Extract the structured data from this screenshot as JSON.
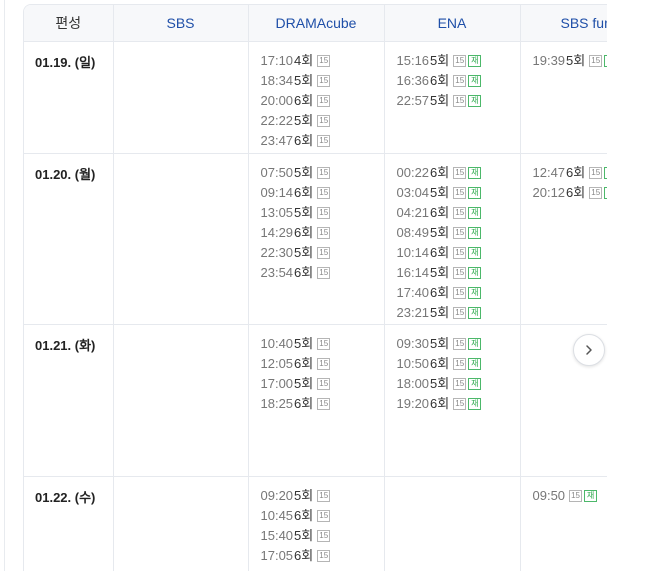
{
  "header": {
    "schedule_label": "편성",
    "channels": [
      "SBS",
      "DRAMAcube",
      "ENA",
      "SBS fun"
    ]
  },
  "badges": {
    "rating": "15",
    "rerun": "재"
  },
  "rows": [
    {
      "date": "01.19. (일)",
      "rowHeight": 112,
      "cells": [
        [],
        [
          {
            "time": "17:10",
            "ep": "4회"
          },
          {
            "time": "18:34",
            "ep": "5회"
          },
          {
            "time": "20:00",
            "ep": "6회"
          },
          {
            "time": "22:22",
            "ep": "5회"
          },
          {
            "time": "23:47",
            "ep": "6회"
          }
        ],
        [
          {
            "time": "15:16",
            "ep": "5회",
            "re": true
          },
          {
            "time": "16:36",
            "ep": "6회",
            "re": true
          },
          {
            "time": "22:57",
            "ep": "5회",
            "re": true
          }
        ],
        [
          {
            "time": "19:39",
            "ep": "5회",
            "re": true
          }
        ]
      ]
    },
    {
      "date": "01.20. (월)",
      "rowHeight": 171,
      "cells": [
        [],
        [
          {
            "time": "07:50",
            "ep": "5회"
          },
          {
            "time": "09:14",
            "ep": "6회"
          },
          {
            "time": "13:05",
            "ep": "5회"
          },
          {
            "time": "14:29",
            "ep": "6회"
          },
          {
            "time": "22:30",
            "ep": "5회"
          },
          {
            "time": "23:54",
            "ep": "6회"
          }
        ],
        [
          {
            "time": "00:22",
            "ep": "6회",
            "re": true
          },
          {
            "time": "03:04",
            "ep": "5회",
            "re": true
          },
          {
            "time": "04:21",
            "ep": "6회",
            "re": true
          },
          {
            "time": "08:49",
            "ep": "5회",
            "re": true
          },
          {
            "time": "10:14",
            "ep": "6회",
            "re": true
          },
          {
            "time": "16:14",
            "ep": "5회",
            "re": true
          },
          {
            "time": "17:40",
            "ep": "6회",
            "re": true
          },
          {
            "time": "23:21",
            "ep": "5회",
            "re": true
          }
        ],
        [
          {
            "time": "12:47",
            "ep": "6회",
            "re": true
          },
          {
            "time": "20:12",
            "ep": "6회",
            "re": true
          }
        ]
      ]
    },
    {
      "date": "01.21. (화)",
      "rowHeight": 152,
      "cells": [
        [],
        [
          {
            "time": "10:40",
            "ep": "5회"
          },
          {
            "time": "12:05",
            "ep": "6회"
          },
          {
            "time": "17:00",
            "ep": "5회"
          },
          {
            "time": "18:25",
            "ep": "6회"
          }
        ],
        [
          {
            "time": "09:30",
            "ep": "5회",
            "re": true
          },
          {
            "time": "10:50",
            "ep": "6회",
            "re": true
          },
          {
            "time": "18:00",
            "ep": "5회",
            "re": true
          },
          {
            "time": "19:20",
            "ep": "6회",
            "re": true
          }
        ],
        []
      ]
    },
    {
      "date": "01.22. (수)",
      "rowHeight": 100,
      "cells": [
        [],
        [
          {
            "time": "09:20",
            "ep": "5회"
          },
          {
            "time": "10:45",
            "ep": "6회"
          },
          {
            "time": "15:40",
            "ep": "5회"
          },
          {
            "time": "17:05",
            "ep": "6회"
          }
        ],
        [],
        [
          {
            "time": "09:50",
            "ep": "",
            "re": true
          }
        ]
      ]
    }
  ]
}
